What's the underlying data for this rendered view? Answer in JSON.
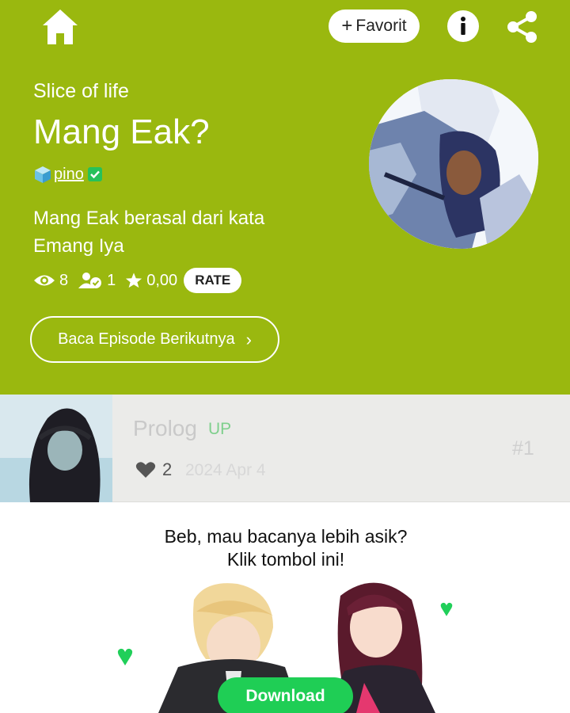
{
  "header": {
    "favorite_label": "Favorit",
    "genre": "Slice of life",
    "title": "Mang Eak?",
    "author": "pino",
    "description": "Mang Eak berasal dari kata Emang Iya",
    "stats": {
      "views": "8",
      "subscribers": "1",
      "rating": "0,00"
    },
    "rate_label": "RATE",
    "next_episode_label": "Baca Episode Berikutnya"
  },
  "episodes": [
    {
      "title": "Prolog",
      "badge": "UP",
      "likes": "2",
      "date": "2024 Apr 4",
      "number": "#1"
    }
  ],
  "promo": {
    "line1": "Beb, mau bacanya lebih asik?",
    "line2": "Klik tombol ini!",
    "download_label": "Download"
  },
  "colors": {
    "header_bg": "#9ab80f",
    "accent_green": "#1fce55",
    "episode_bg": "#ebebe9"
  },
  "icons": [
    "home-icon",
    "plus-icon",
    "info-icon",
    "share-icon",
    "cube-icon",
    "verified-icon",
    "eye-icon",
    "subscriber-icon",
    "star-icon",
    "chevron-right-icon",
    "heart-icon"
  ]
}
